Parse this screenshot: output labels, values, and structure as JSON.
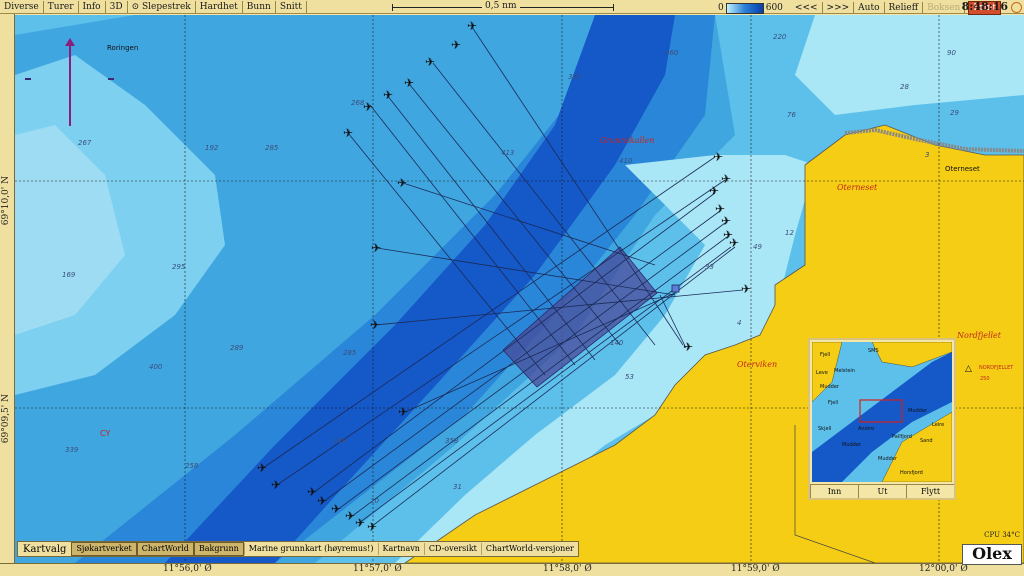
{
  "toolbar": {
    "items": [
      "Diverse",
      "Turer",
      "Info",
      "3D",
      "Slepestrek",
      "Hardhet",
      "Bunn",
      "Snitt"
    ],
    "scale_label": "0,5 nm",
    "depth_min": "0",
    "depth_max": "600",
    "right_items": [
      "<<<",
      ">>>",
      "Auto",
      "Relieff",
      "Boksen"
    ],
    "print_label": "Print",
    "time": "8:48:16"
  },
  "latitudes": [
    "69°10,0' N",
    "69°09,5' N"
  ],
  "longitudes": [
    "11°56,0' Ø",
    "11°57,0' Ø",
    "11°58,0' Ø",
    "11°59,0' Ø",
    "12°00,0' Ø"
  ],
  "place_labels": {
    "roringen": "Roringen",
    "oterneset": "Oterneset",
    "oterneset_top": "Oterneset",
    "oterviken": "Oterviken",
    "nordfjellet": "Nordfjellet",
    "nordfjellet_marker": "NORDFJELLET",
    "cy": "CY",
    "grunn": "Grunnskallen"
  },
  "depth_labels": [
    "267",
    "192",
    "285",
    "169",
    "295",
    "289",
    "400",
    "285",
    "268",
    "330",
    "413",
    "460",
    "410",
    "388",
    "31",
    "28",
    "29",
    "76",
    "12",
    "49",
    "33",
    "4",
    "140",
    "53",
    "358",
    "20",
    "3",
    "90",
    "220",
    "339",
    "258"
  ],
  "kartvalg": {
    "title": "Kartvalg",
    "options": [
      "Sjøkartverket",
      "ChartWorld",
      "Bakgrunn",
      "Marine grunnkart (høyremus!)",
      "Kartnavn",
      "CD-oversikt",
      "ChartWorld-versjoner"
    ],
    "active": [
      0,
      1,
      2
    ]
  },
  "inset": {
    "buttons": [
      "Inn",
      "Ut",
      "Flytt"
    ],
    "labels": [
      "SMS",
      "Fjell",
      "Leve",
      "Melstein",
      "Mudder",
      "Mudder",
      "Skjell",
      "Anstro",
      "Pallfjord",
      "Horsfjord",
      "Sand",
      "Fjell",
      "Mudder",
      "Mudder",
      "Leire"
    ]
  },
  "status": {
    "cpu": "CPU 34°C",
    "brand": "Olex",
    "nordfjellet_depth": "250"
  },
  "colors": {
    "deep": "#1558c8",
    "mid": "#2a86d8",
    "shallow": "#5cc0ea",
    "very_shallow": "#a9e6f6",
    "land": "#f4cd14",
    "track": "#1b2a58",
    "highlight": "#4a4a9a"
  }
}
